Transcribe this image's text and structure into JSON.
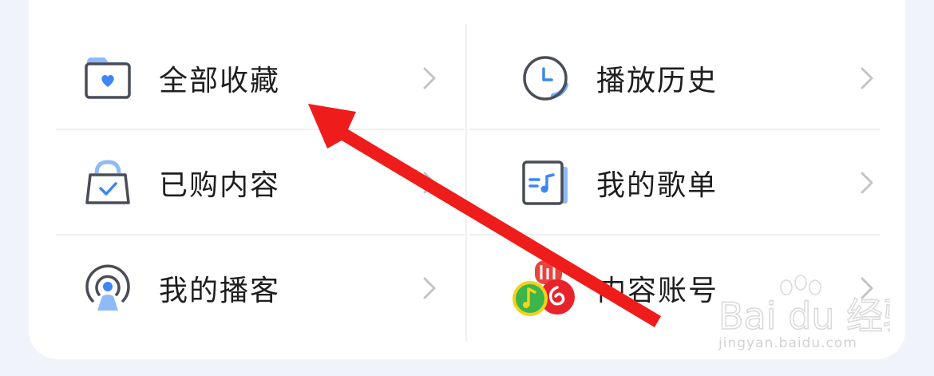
{
  "menu": {
    "items": [
      {
        "label": "全部收藏",
        "icon": "heart-folder-icon"
      },
      {
        "label": "播放历史",
        "icon": "clock-icon"
      },
      {
        "label": "已购内容",
        "icon": "shopping-bag-check-icon"
      },
      {
        "label": "我的歌单",
        "icon": "playlist-music-icon"
      },
      {
        "label": "我的播客",
        "icon": "podcast-broadcast-icon"
      },
      {
        "label": "内容账号",
        "icon": "music-apps-icon"
      }
    ]
  },
  "watermark": {
    "logo_text": "Bai du 经验",
    "url": "jingyan.baidu.com"
  },
  "colors": {
    "accent_blue": "#4a8ef5",
    "icon_stroke": "#4a4d57",
    "arrow_red": "#ef1c1c"
  }
}
